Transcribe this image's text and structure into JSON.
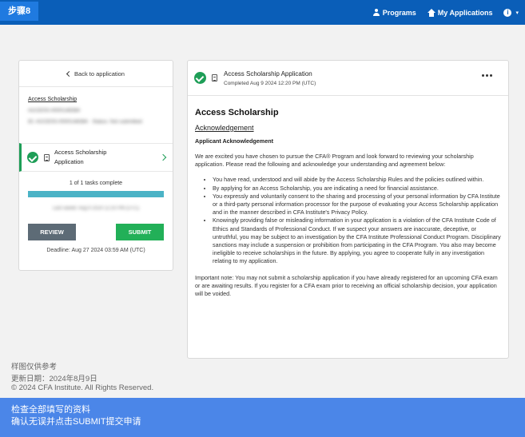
{
  "colors": {
    "topbar": "#0a5eb8",
    "accent_green": "#1e9e57",
    "submit_green": "#22b058",
    "review_gray": "#5d6b76",
    "progress": "#4bb3c6",
    "banner": "#4b86e8"
  },
  "header": {
    "step_label": "步骤8",
    "nav": {
      "programs": "Programs",
      "my_applications": "My Applications"
    },
    "icons": [
      "person-icon",
      "home-icon",
      "info-icon"
    ]
  },
  "sidebar": {
    "back_label": "Back to application",
    "app_link": "Access Scholarship",
    "app_id_blurred": "ACCESS-0000148384",
    "status_line_blurred": "ID: ACCESS-0000148384 · Status: Not submitted",
    "task": {
      "label": "Access Scholarship Application"
    },
    "progress": {
      "text": "1 of 1 tasks complete",
      "fraction": 1.0,
      "last_saved_blurred": "Last saved: Aug 9 2024 12:20 PM (UTC)"
    },
    "review_button": "REVIEW",
    "submit_button": "SUBMIT",
    "deadline": "Deadline: Aug 27 2024 03:59 AM (UTC)"
  },
  "main": {
    "card_title": "Access Scholarship Application",
    "completed_text": "Completed Aug 9 2024 12:20 PM (UTC)",
    "heading": "Access Scholarship",
    "subheading": "Acknowledgement",
    "section_title": "Applicant Acknowledgement",
    "intro": "We are excited you have chosen to pursue the CFA® Program and look forward to reviewing your scholarship application. Please read the following and acknowledge your understanding and agreement below:",
    "bullets": [
      "You have read, understood and will abide by the Access Scholarship Rules and the policies outlined within.",
      "By applying for an Access Scholarship, you are indicating a need for financial assistance.",
      "You expressly and voluntarily consent to the sharing and processing of your personal information by CFA Institute or a third-party personal information processor for the purpose of evaluating your Access Scholarship application and in the manner described in CFA Institute's Privacy Policy.",
      "Knowingly providing false or misleading information in your application is a violation of the CFA Institute Code of Ethics and Standards of Professional Conduct. If we suspect your answers are inaccurate, deceptive, or untruthful, you may be subject to an investigation by the CFA Institute Professional Conduct Program. Disciplinary sanctions may include a suspension or prohibition from participating in the CFA Program. You also may become ineligible to receive scholarships in the future. By applying, you agree to cooperate fully in any investigation relating to my application."
    ],
    "note": "Important note: You may not submit a scholarship application if you have already registered for an upcoming CFA exam or are awaiting results. If you register for a CFA exam prior to receiving an official scholarship decision, your application will be voided."
  },
  "footer": {
    "line1": "样图仅供参考",
    "line2": "更新日期：2024年8月9日",
    "line3": "© 2024 CFA Institute. All Rights Reserved."
  },
  "banner": {
    "line1": "检查全部填写的资料",
    "line2": "确认无误并点击SUBMIT提交申请"
  }
}
